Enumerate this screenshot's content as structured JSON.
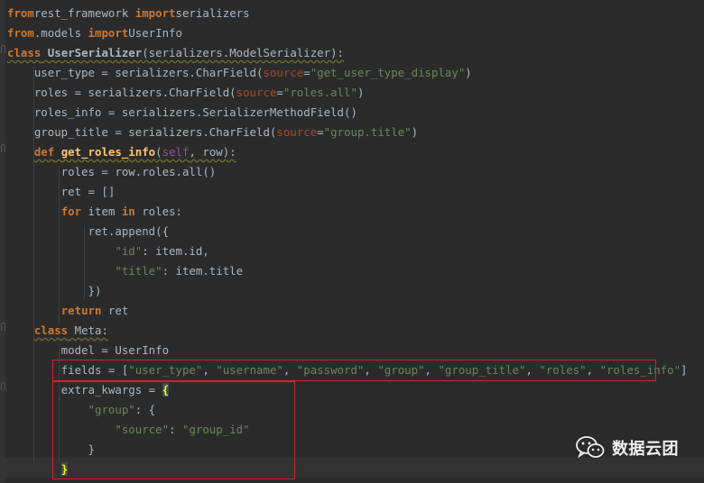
{
  "editor": {
    "lines": [
      {
        "t": [
          [
            "kw",
            "from"
          ],
          [
            "",
            "rest_framework "
          ],
          [
            "kw",
            "import"
          ],
          [
            "",
            "serializers"
          ]
        ]
      },
      {
        "t": [
          [
            "kw",
            "from"
          ],
          [
            "",
            ".models "
          ],
          [
            "kw",
            "import"
          ],
          [
            "",
            "UserInfo"
          ]
        ]
      },
      {
        "t": [
          [
            "kw wavy",
            "class"
          ],
          [
            "wavy",
            " "
          ],
          [
            "cls wavy",
            "UserSerializer"
          ],
          [
            "wavy",
            "(serializers.ModelSerializer):"
          ]
        ]
      },
      {
        "t": [
          [
            "",
            "    user_type = serializers.CharField("
          ],
          [
            "par",
            "source"
          ],
          [
            "",
            "="
          ],
          [
            "str",
            "\"get_user_type_display\""
          ],
          [
            "",
            ")"
          ]
        ]
      },
      {
        "t": [
          [
            "",
            "    roles = serializers.CharField("
          ],
          [
            "par",
            "source"
          ],
          [
            "",
            "="
          ],
          [
            "str",
            "\"roles.all\""
          ],
          [
            "",
            ")"
          ]
        ]
      },
      {
        "t": [
          [
            "",
            "    roles_info = serializers.SerializerMethodField()"
          ]
        ]
      },
      {
        "t": [
          [
            "",
            "    group_title = serializers.CharField("
          ],
          [
            "par",
            "source"
          ],
          [
            "",
            "="
          ],
          [
            "str",
            "\"group.title\""
          ],
          [
            "",
            ")"
          ]
        ]
      },
      {
        "t": [
          [
            "",
            "    "
          ],
          [
            "kw wavy",
            "def"
          ],
          [
            "wavy",
            " "
          ],
          [
            "fn wavy",
            "get_roles_info"
          ],
          [
            "wavy",
            "("
          ],
          [
            "self wavy",
            "self"
          ],
          [
            "wavy",
            ", row):"
          ]
        ]
      },
      {
        "t": [
          [
            "",
            "        roles = row.roles.all()"
          ]
        ]
      },
      {
        "t": [
          [
            "",
            "        ret = []"
          ]
        ]
      },
      {
        "t": [
          [
            "",
            "        "
          ],
          [
            "kw",
            "for"
          ],
          [
            "",
            " item "
          ],
          [
            "kw",
            "in"
          ],
          [
            "",
            " roles:"
          ]
        ]
      },
      {
        "t": [
          [
            "",
            "            ret.append({"
          ]
        ]
      },
      {
        "t": [
          [
            "",
            "                "
          ],
          [
            "str",
            "\"id\""
          ],
          [
            "",
            ": item.id,"
          ]
        ]
      },
      {
        "t": [
          [
            "",
            "                "
          ],
          [
            "str",
            "\"title\""
          ],
          [
            "",
            ": item.title"
          ]
        ]
      },
      {
        "t": [
          [
            "",
            "            })"
          ]
        ]
      },
      {
        "t": [
          [
            "",
            "        "
          ],
          [
            "kw",
            "return"
          ],
          [
            "",
            " ret"
          ]
        ]
      },
      {
        "t": [
          [
            "",
            "    "
          ],
          [
            "kw wavy",
            "class"
          ],
          [
            "wavy",
            " Meta:"
          ]
        ]
      },
      {
        "t": [
          [
            "",
            "        model = UserInfo"
          ]
        ]
      },
      {
        "t": [
          [
            "",
            "        fields = ["
          ],
          [
            "str",
            "\"user_type\""
          ],
          [
            "",
            ", "
          ],
          [
            "str",
            "\"username\""
          ],
          [
            "",
            ", "
          ],
          [
            "str",
            "\"password\""
          ],
          [
            "",
            ", "
          ],
          [
            "str",
            "\"group\""
          ],
          [
            "",
            ", "
          ],
          [
            "str",
            "\"group_title\""
          ],
          [
            "",
            ", "
          ],
          [
            "str",
            "\"roles\""
          ],
          [
            "",
            ", "
          ],
          [
            "str",
            "\"roles_info\""
          ],
          [
            "",
            "]"
          ]
        ]
      },
      {
        "t": [
          [
            "",
            "        extra_kwargs = "
          ],
          [
            "brace-hl",
            "{"
          ]
        ]
      },
      {
        "t": [
          [
            "",
            "            "
          ],
          [
            "str",
            "\"group\""
          ],
          [
            "",
            ": {"
          ]
        ]
      },
      {
        "t": [
          [
            "",
            "                "
          ],
          [
            "str",
            "\"source\""
          ],
          [
            "",
            ": "
          ],
          [
            "str",
            "\"group_id\""
          ]
        ]
      },
      {
        "t": [
          [
            "",
            "            }"
          ]
        ]
      },
      {
        "t": [
          [
            "",
            "        "
          ],
          [
            "brace-hl",
            "}"
          ]
        ]
      }
    ]
  },
  "colors": {
    "highlight_box": "#d8202a",
    "keyword": "#cc7832",
    "string": "#6a8759",
    "param": "#aa4926"
  },
  "watermark": {
    "icon": "wechat-icon",
    "text": "数据云团"
  }
}
